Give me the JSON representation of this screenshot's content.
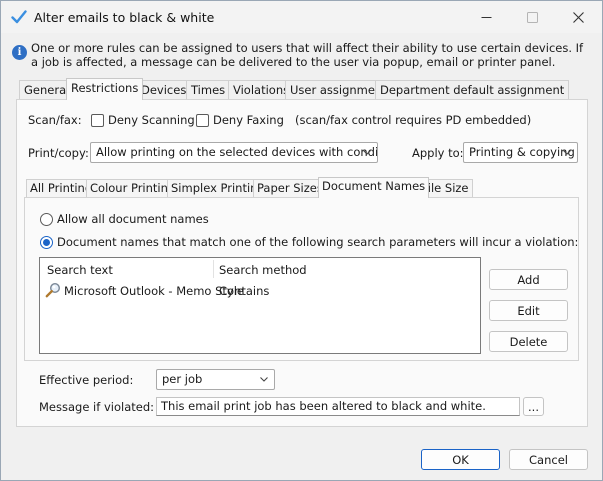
{
  "window": {
    "title": "Alter emails to black & white",
    "icon": "checkmark-icon",
    "controls": [
      "minimize-icon",
      "maximize-icon",
      "close-icon"
    ]
  },
  "info": {
    "icon": "info-icon",
    "text": "One or more rules can be assigned to users that will affect their ability to use certain devices. If a job is affected, a message can be delivered to the user via popup, email or printer panel."
  },
  "tabs": [
    {
      "label": "General",
      "active": false
    },
    {
      "label": "Restrictions",
      "active": true
    },
    {
      "label": "Devices",
      "active": false
    },
    {
      "label": "Times",
      "active": false
    },
    {
      "label": "Violations",
      "active": false
    },
    {
      "label": "User assignment",
      "active": false
    },
    {
      "label": "Department default assignment",
      "active": false
    }
  ],
  "restrictions": {
    "scan_fax_label": "Scan/fax:",
    "deny_scanning_label": "Deny Scanning",
    "deny_scanning_checked": false,
    "deny_faxing_label": "Deny Faxing",
    "deny_faxing_checked": false,
    "scan_fax_note": "(scan/fax control requires PD embedded)",
    "print_copy_label": "Print/copy:",
    "print_copy_value": "Allow printing on the selected devices with conditions:",
    "apply_to_label": "Apply to:",
    "apply_to_value": "Printing & copying"
  },
  "subtabs": [
    {
      "label": "All Printing",
      "active": false
    },
    {
      "label": "Colour Printing",
      "active": false
    },
    {
      "label": "Simplex Printing",
      "active": false
    },
    {
      "label": "Paper Sizes",
      "active": false
    },
    {
      "label": "Document Names",
      "active": true
    },
    {
      "label": "File Size",
      "active": false
    }
  ],
  "document_names": {
    "allow_all_label": "Allow all document names",
    "allow_all_selected": false,
    "match_label": "Document names that match one of the following search parameters will incur a violation:",
    "match_selected": true,
    "columns": [
      "Search text",
      "Search method"
    ],
    "rows": [
      {
        "search_text": "Microsoft Outlook - Memo Style",
        "search_method": "Contains",
        "icon": "magnifier-icon"
      }
    ],
    "add_label": "Add",
    "edit_label": "Edit",
    "delete_label": "Delete"
  },
  "effective_period": {
    "label": "Effective period:",
    "value": "per job"
  },
  "message": {
    "label": "Message if violated:",
    "value": "This email print job has been altered to black and white.",
    "browse_label": "..."
  },
  "footer": {
    "ok_label": "OK",
    "cancel_label": "Cancel"
  },
  "colors": {
    "accent": "#1a63c7",
    "window_bg": "#f0f0f0",
    "panel_bg": "#fafafa"
  }
}
